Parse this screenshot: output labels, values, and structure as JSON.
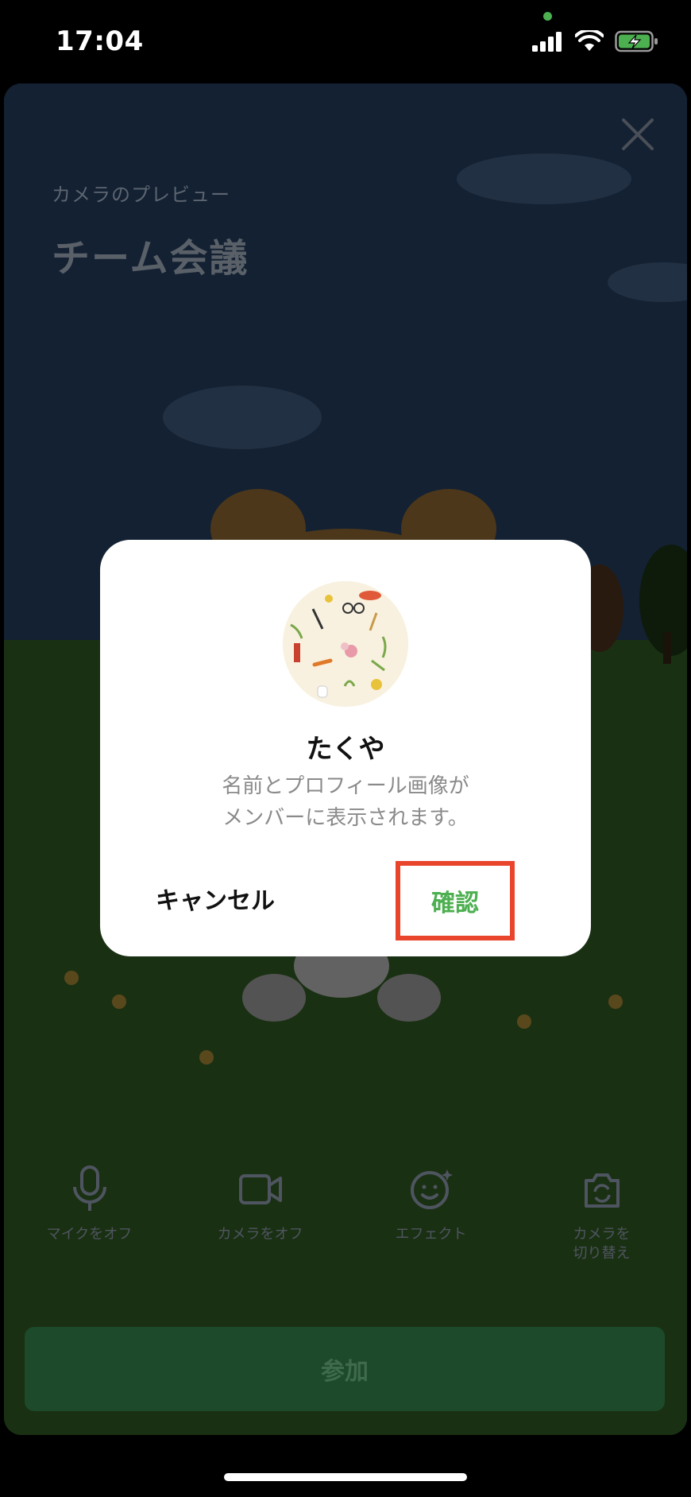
{
  "status_bar": {
    "time": "17:04"
  },
  "preview": {
    "label": "カメラのプレビュー",
    "meeting_title": "チーム会議"
  },
  "controls": [
    {
      "label": "マイクをオフ",
      "icon": "microphone-icon"
    },
    {
      "label": "カメラをオフ",
      "icon": "video-camera-icon"
    },
    {
      "label": "エフェクト",
      "icon": "effect-face-icon"
    },
    {
      "label": "カメラを\n切り替え",
      "icon": "switch-camera-icon"
    }
  ],
  "join_button": {
    "label": "参加"
  },
  "dialog": {
    "name": "たくや",
    "message_line1": "名前とプロフィール画像が",
    "message_line2": "メンバーに表示されます。",
    "cancel_label": "キャンセル",
    "confirm_label": "確認"
  },
  "colors": {
    "accent_green": "#4caf50",
    "highlight_red": "#e8452c",
    "join_button_bg": "#1c4a2a"
  }
}
